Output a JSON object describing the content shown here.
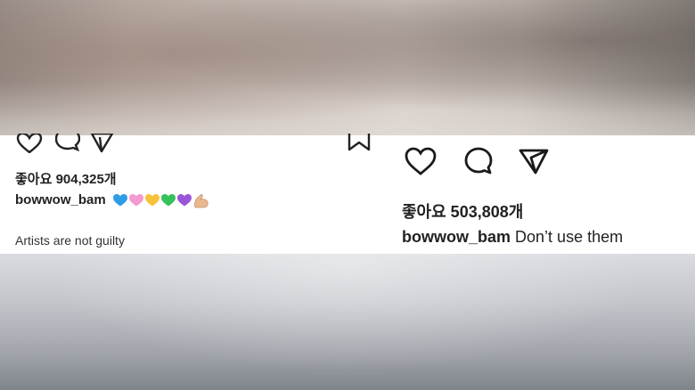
{
  "posts": [
    {
      "likes_label": "좋아요 904,325개",
      "username": "bowwow_bam",
      "caption_text": "",
      "emojis": [
        {
          "name": "blue-heart-icon",
          "color": "#2e9be6"
        },
        {
          "name": "pink-heart-icon",
          "color": "#f39ad0"
        },
        {
          "name": "yellow-heart-icon",
          "color": "#f7c23a"
        },
        {
          "name": "green-heart-icon",
          "color": "#35c25a"
        },
        {
          "name": "purple-heart-icon",
          "color": "#9b55d9"
        },
        {
          "name": "flexed-biceps-icon",
          "color": "#e9b88f"
        }
      ],
      "comment_text": "Artists are not guilty"
    },
    {
      "likes_label": "좋아요 503,808개",
      "username": "bowwow_bam",
      "caption_text": "Don’t use them"
    }
  ]
}
